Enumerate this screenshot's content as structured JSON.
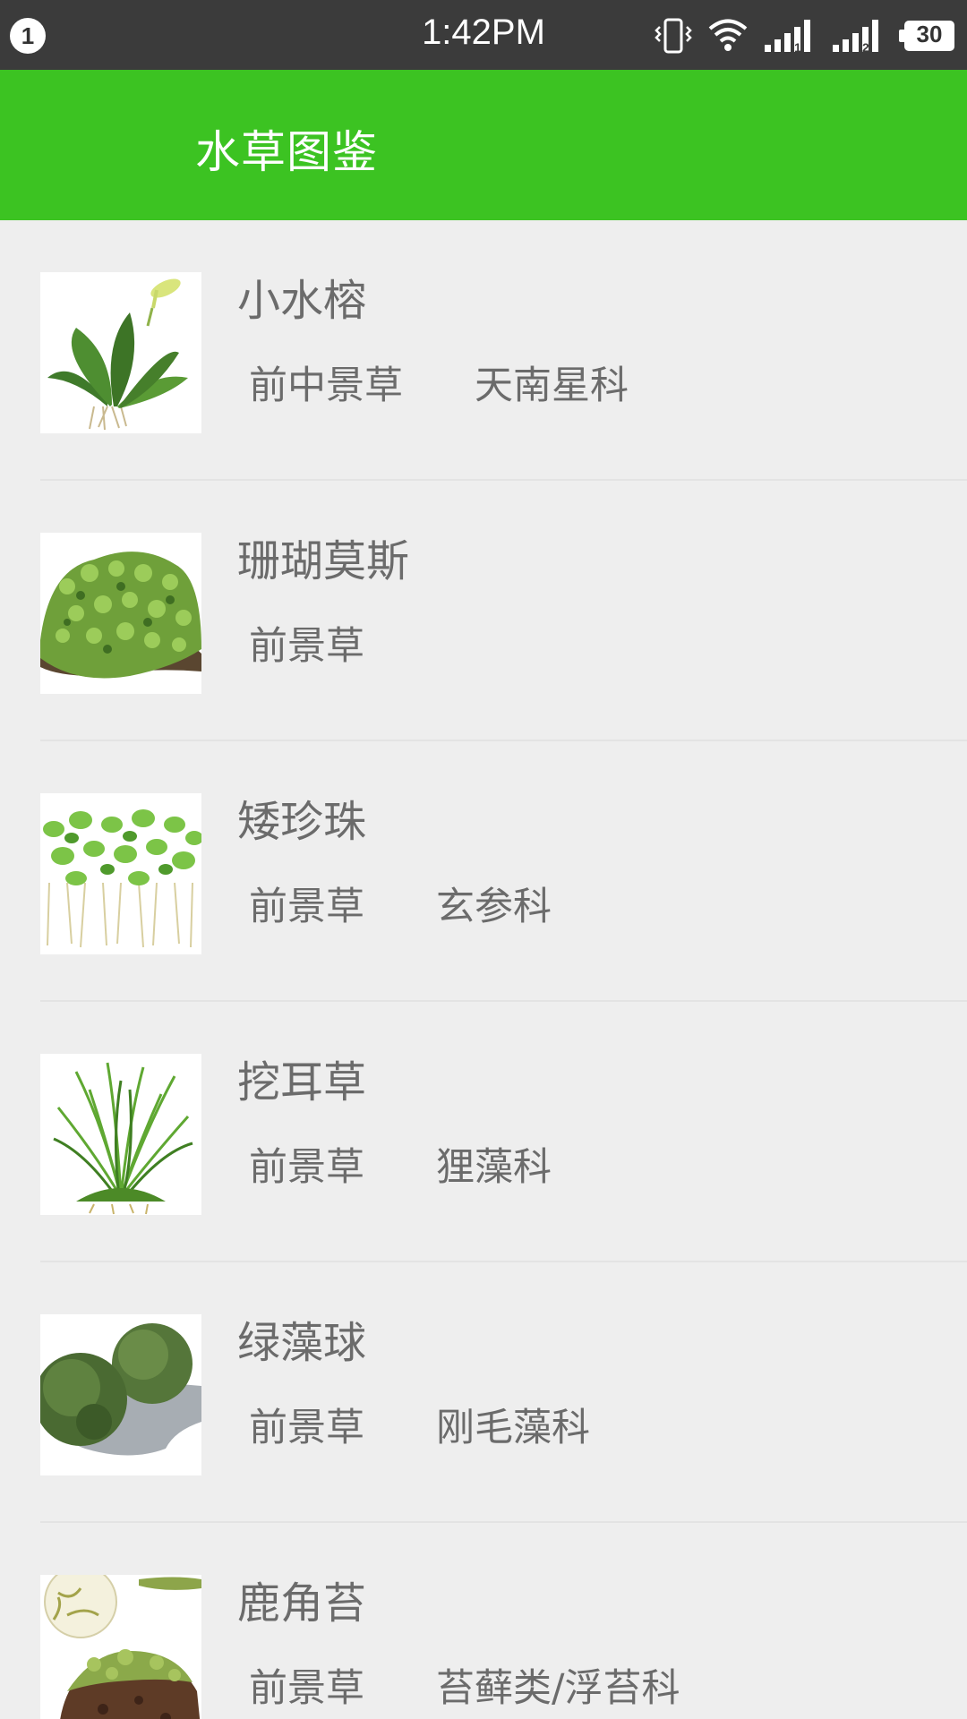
{
  "status_bar": {
    "notification_count": "1",
    "time": "1:42PM",
    "battery_level": "30",
    "icons": [
      "vibrate-icon",
      "wifi-icon",
      "signal-sim1-icon",
      "signal-sim2-icon",
      "battery-icon"
    ]
  },
  "app_bar": {
    "title": "水草图鉴",
    "color": "#3cc322"
  },
  "plants": [
    {
      "name": "小水榕",
      "position": "前中景草",
      "family": "天南星科",
      "image": "anubias-plant-image"
    },
    {
      "name": "珊瑚莫斯",
      "position": "前景草",
      "family": "",
      "image": "coral-moss-image"
    },
    {
      "name": "矮珍珠",
      "position": "前景草",
      "family": "玄参科",
      "image": "dwarf-pearl-grass-image"
    },
    {
      "name": "挖耳草",
      "position": "前景草",
      "family": "狸藻科",
      "image": "utricularia-image"
    },
    {
      "name": "绿藻球",
      "position": "前景草",
      "family": "刚毛藻科",
      "image": "marimo-ball-image"
    },
    {
      "name": "鹿角苔",
      "position": "前景草",
      "family": "苔藓类/浮苔科",
      "image": "riccia-image"
    }
  ]
}
